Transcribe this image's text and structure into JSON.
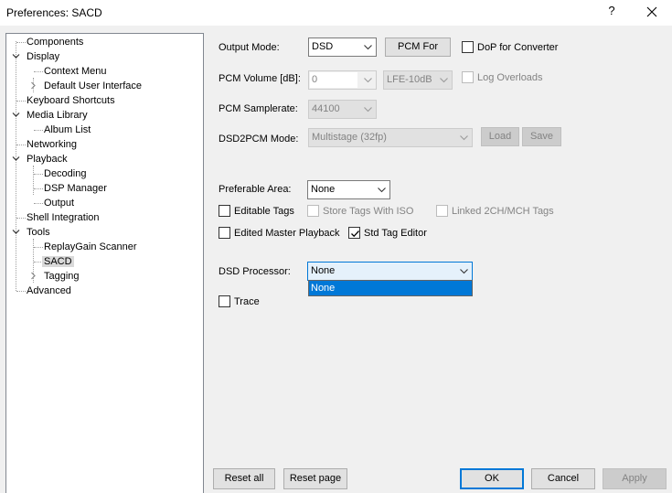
{
  "window": {
    "title": "Preferences: SACD",
    "help_glyph": "?"
  },
  "tree": {
    "items": [
      {
        "label": "Components"
      },
      {
        "label": "Display"
      },
      {
        "label": "Context Menu"
      },
      {
        "label": "Default User Interface"
      },
      {
        "label": "Keyboard Shortcuts"
      },
      {
        "label": "Media Library"
      },
      {
        "label": "Album List"
      },
      {
        "label": "Networking"
      },
      {
        "label": "Playback"
      },
      {
        "label": "Decoding"
      },
      {
        "label": "DSP Manager"
      },
      {
        "label": "Output"
      },
      {
        "label": "Shell Integration"
      },
      {
        "label": "Tools"
      },
      {
        "label": "ReplayGain Scanner"
      },
      {
        "label": "SACD",
        "selected": true
      },
      {
        "label": "Tagging"
      },
      {
        "label": "Advanced"
      }
    ]
  },
  "settings": {
    "output_mode_label": "Output Mode:",
    "output_mode_value": "DSD",
    "pcm_for_button": "PCM For",
    "dop_label": "DoP for Converter",
    "pcm_volume_label": "PCM Volume [dB]:",
    "pcm_volume_value": "0",
    "lfe_value": "LFE-10dB",
    "log_overloads_label": "Log Overloads",
    "pcm_samplerate_label": "PCM Samplerate:",
    "pcm_samplerate_value": "44100",
    "dsd2pcm_label": "DSD2PCM Mode:",
    "dsd2pcm_value": "Multistage (32fp)",
    "load_button": "Load",
    "save_button": "Save",
    "preferable_area_label": "Preferable Area:",
    "preferable_area_value": "None",
    "editable_tags_label": "Editable Tags",
    "store_tags_label": "Store Tags With ISO",
    "linked_tags_label": "Linked 2CH/MCH Tags",
    "edited_master_label": "Edited Master Playback",
    "std_tag_editor_label": "Std Tag Editor",
    "dsd_processor_label": "DSD Processor:",
    "dsd_processor_value": "None",
    "dsd_processor_options": [
      "None"
    ],
    "trace_label": "Trace"
  },
  "footer": {
    "reset_all": "Reset all",
    "reset_page": "Reset page",
    "ok": "OK",
    "cancel": "Cancel",
    "apply": "Apply"
  },
  "colors": {
    "accent": "#0078d7",
    "selection_bg": "#0078d7"
  }
}
